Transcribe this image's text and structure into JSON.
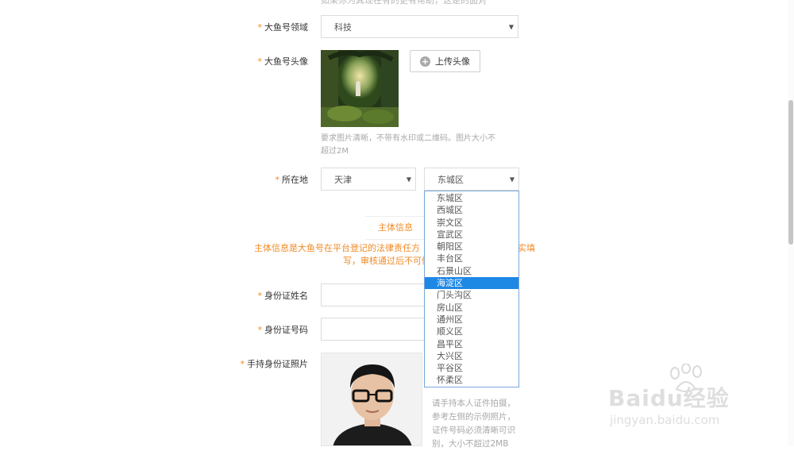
{
  "top_cut_text": "如果你为其现在有的更有帮助，这是的面对",
  "domain": {
    "label": "大鱼号领域",
    "value": "科技"
  },
  "avatar": {
    "label": "大鱼号头像",
    "upload_label": "上传头像",
    "hint_line1": "要求图片清晰，不带有水印或二维码。图片大小不",
    "hint_line2": "超过2M"
  },
  "location": {
    "label": "所在地",
    "city": "天津",
    "district": "东城区",
    "options": [
      "东城区",
      "西城区",
      "崇文区",
      "宣武区",
      "朝阳区",
      "丰台区",
      "石景山区",
      "海淀区",
      "门头沟区",
      "房山区",
      "通州区",
      "顺义区",
      "昌平区",
      "大兴区",
      "平谷区",
      "怀柔区"
    ],
    "highlighted": "海淀区"
  },
  "subject": {
    "section_title": "主体信息",
    "notice_line1": "主体信息是大鱼号在平台登记的法律责任方",
    "notice_line1_tail": "实填",
    "notice_line2": "写，审核通过后不可修"
  },
  "id_name": {
    "label": "身份证姓名"
  },
  "id_number": {
    "label": "身份证号码"
  },
  "id_photo": {
    "label": "手持身份证照片",
    "hint": [
      "请手持本人证件拍摄，",
      "参考左侧的示例照片，",
      "证件号码必须清晰可识",
      "别，大小不超过2MB"
    ]
  },
  "required_mark": "*",
  "watermark": {
    "brand": "Baidu经验",
    "url": "jingyan.baidu.com"
  },
  "colors": {
    "accent": "#f08a24",
    "highlight": "#1e88e5",
    "dropdown_border": "#7aa7d8"
  }
}
